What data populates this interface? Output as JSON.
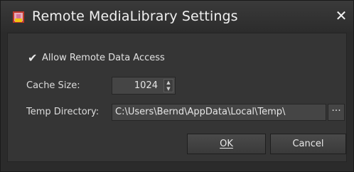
{
  "window": {
    "title": "Remote MediaLibrary Settings",
    "close_glyph": "✕"
  },
  "settings": {
    "allow_remote_label": "Allow Remote Data Access",
    "allow_remote_checked": true,
    "cache_size_label": "Cache Size:",
    "cache_size_value": "1024",
    "temp_dir_label": "Temp Directory:",
    "temp_dir_value": "C:\\Users\\Bernd\\AppData\\Local\\Temp\\",
    "browse_label": "···"
  },
  "buttons": {
    "ok_label": "OK",
    "cancel_label": "Cancel"
  },
  "colors": {
    "window_bg": "#2b2b2b",
    "panel_bg": "#353535",
    "field_bg": "#454545",
    "text": "#e6e6e6"
  },
  "icons": [
    "app-icon",
    "close-icon",
    "checkmark-icon",
    "spin-up-icon",
    "spin-down-icon",
    "browse-icon"
  ]
}
